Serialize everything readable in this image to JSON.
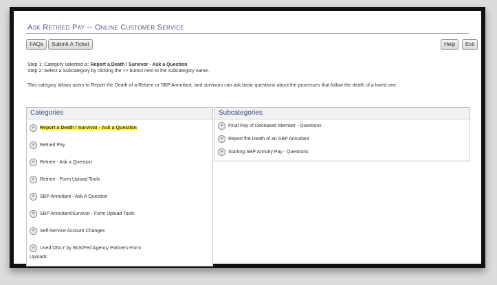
{
  "header": {
    "title": "Ask Retired Pay -- Online Customer Service"
  },
  "toolbar": {
    "faqs_label": "FAQs",
    "submit_ticket_label": "Submit A Ticket",
    "help_label": "Help",
    "exit_label": "Exit"
  },
  "steps": {
    "step1_prefix": "Step 1: Category selected is: ",
    "step1_value": "Report a Death / Survivor - Ask a Question",
    "step2": "Step 2: Select a Subcategory by clicking the >> button next to the subcategory name."
  },
  "description": "This category allows users to Report the Death of a Retiree or SBP Annuitant, and survivors can ask basic questions about the processes that follow the death of a loved one.",
  "categories": {
    "header": "Categories",
    "items": [
      {
        "label": "Report a Death / Survivor - Ask a Question"
      },
      {
        "label": "Retired Pay"
      },
      {
        "label": "Retiree - Ask a Question"
      },
      {
        "label": "Retiree - Form Upload Tools"
      },
      {
        "label": "SBP Annuitant - Ask A Question"
      },
      {
        "label": "SBP Annuitant/Survivor - Form Upload Tools"
      },
      {
        "label": "Self-Service Account Changes"
      },
      {
        "label": "Used ONLY by BoS/Fed Agency Partners-Form"
      },
      {
        "label": "Uploads"
      }
    ]
  },
  "subcategories": {
    "header": "Subcategories",
    "items": [
      {
        "label": "Final Pay of Deceased Member - Questions"
      },
      {
        "label": "Report the Death of an SBP Annuitant"
      },
      {
        "label": "Starting SBP Annuity Pay - Questions"
      }
    ]
  },
  "arrow_glyph": "»"
}
